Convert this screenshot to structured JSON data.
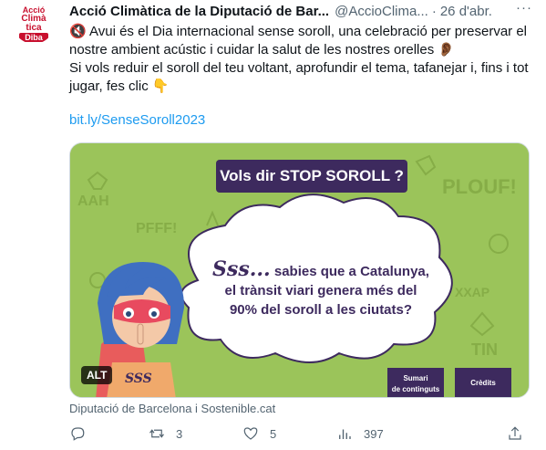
{
  "account": {
    "name": "Acció Climàtica de la Diputació de Bar...",
    "handle": "@AccioClima...",
    "separator": "·",
    "date": "26 d'abr.",
    "avatar": {
      "line1": "Acció",
      "line2": "Climà",
      "line3": "tica",
      "line4": "Diba"
    }
  },
  "tweet": {
    "line1": "🔇 Avui és el Dia internacional sense soroll, una celebració per preservar el nostre ambient acústic i cuidar la salut de les nostres orelles 👂🏾",
    "line2": "Si vols reduir el soroll del teu voltant, aprofundir el tema, tafanejar i, fins i tot jugar, fes clic 👇",
    "link": "bit.ly/SenseSoroll2023"
  },
  "media": {
    "banner": "Vols dir STOP SOROLL ?",
    "bubble_sss": "Sss...",
    "bubble_line1": "sabies que a Catalunya,",
    "bubble_line2": "el trànsit viari genera més del",
    "bubble_line3": "90% del soroll a les ciutats?",
    "button_sumari_1": "Sumari",
    "button_sumari_2": "de continguts",
    "button_credits": "Crèdits",
    "alt_badge": "ALT",
    "bg_words": [
      "PLOUF!",
      "PFFF!",
      "AAH",
      "TIN",
      "XXAP"
    ],
    "colors": {
      "background": "#9bc45a",
      "purple": "#3d2a5e"
    }
  },
  "caption": "Diputació de Barcelona i Sostenible.cat",
  "actions": {
    "reply": "",
    "retweet": "3",
    "like": "5",
    "views": "397"
  }
}
